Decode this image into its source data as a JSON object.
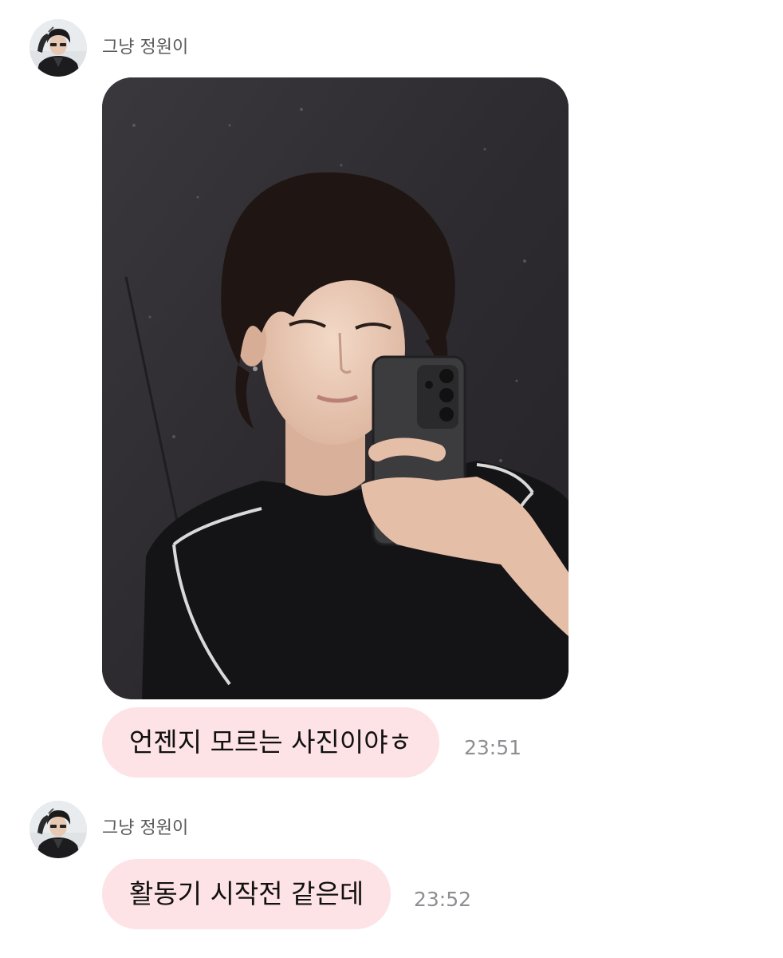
{
  "chat": {
    "messages": [
      {
        "sender": "그냥 정원이",
        "type": "photo",
        "avatar_icon": "profile-photo",
        "image_desc": "mirror-selfie-photo"
      },
      {
        "sender": "그냥 정원이",
        "type": "text",
        "text": "언젠지 모르는 사진이야ㅎ",
        "time": "23:51"
      },
      {
        "sender": "그냥 정원이",
        "type": "text",
        "text": "활동기 시작전 같은데",
        "time": "23:52",
        "avatar_icon": "profile-photo"
      }
    ]
  },
  "colors": {
    "bubble_bg": "#fde2e6",
    "timestamp": "#8e8e93",
    "sender_name": "#5a5a5a"
  }
}
